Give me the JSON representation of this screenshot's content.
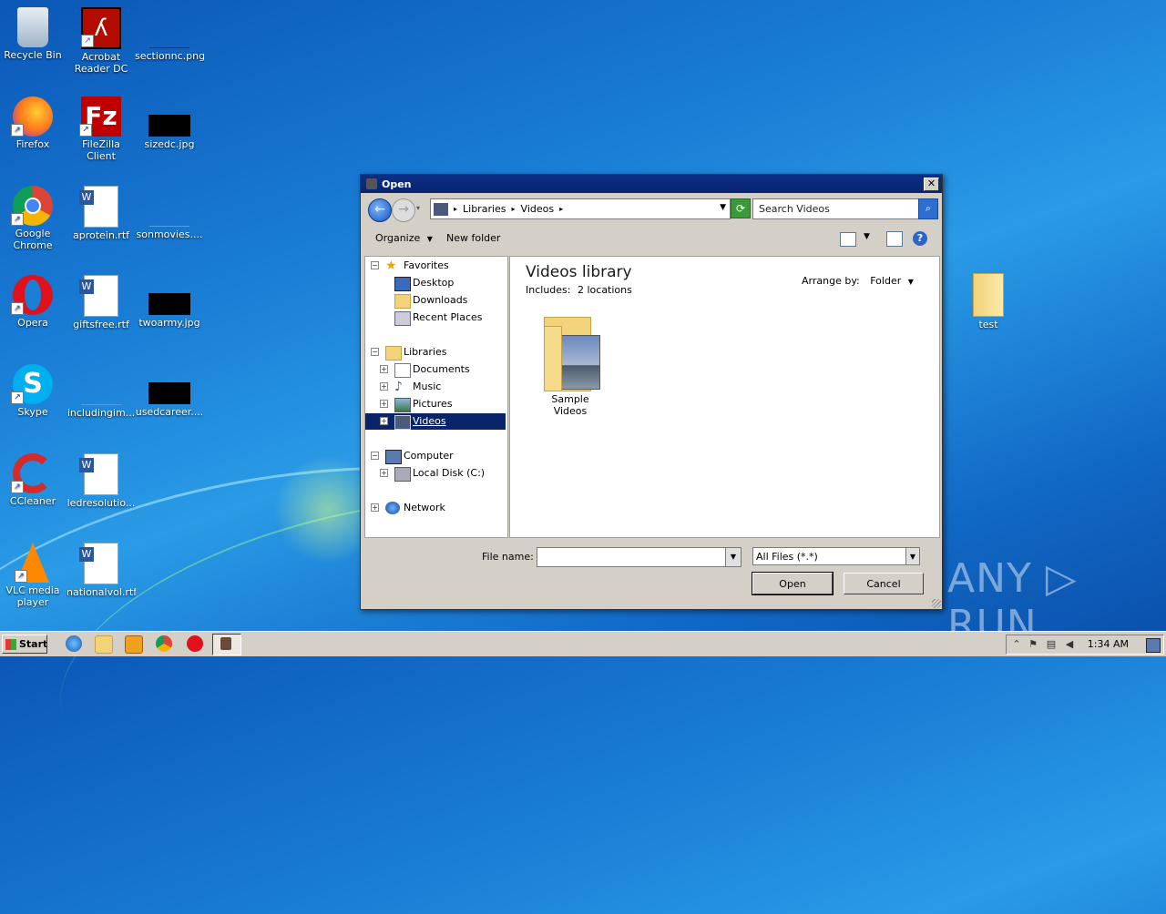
{
  "desktop": {
    "icons": [
      {
        "label": "Recycle Bin"
      },
      {
        "label": "Acrobat Reader DC"
      },
      {
        "label": "sectionnc.png"
      },
      {
        "label": "Firefox"
      },
      {
        "label": "FileZilla Client"
      },
      {
        "label": "sizedc.jpg"
      },
      {
        "label": "Google Chrome"
      },
      {
        "label": "aprotein.rtf"
      },
      {
        "label": "sonmovies...."
      },
      {
        "label": "Opera"
      },
      {
        "label": "giftsfree.rtf"
      },
      {
        "label": "twoarmy.jpg"
      },
      {
        "label": "Skype"
      },
      {
        "label": "includingim..."
      },
      {
        "label": "usedcareer...."
      },
      {
        "label": "CCleaner"
      },
      {
        "label": "ledresolutio..."
      },
      {
        "label": "VLC media player"
      },
      {
        "label": "nationalvol.rtf"
      },
      {
        "label": "test"
      }
    ],
    "watermark": "ANY ▷ RUN"
  },
  "dialog": {
    "title": "Open",
    "close_glyph": "✕",
    "address": {
      "crumbs": [
        "Libraries",
        "Videos"
      ]
    },
    "search": {
      "placeholder": "Search Videos"
    },
    "toolbar": {
      "organize": "Organize",
      "new_folder": "New folder"
    },
    "nav": {
      "favorites": "Favorites",
      "desktop": "Desktop",
      "downloads": "Downloads",
      "recent_places": "Recent Places",
      "libraries": "Libraries",
      "documents": "Documents",
      "music": "Music",
      "pictures": "Pictures",
      "videos": "Videos",
      "computer": "Computer",
      "local_disk": "Local Disk (C:)",
      "network": "Network"
    },
    "content": {
      "title": "Videos library",
      "includes_label": "Includes:",
      "includes_value": "2 locations",
      "arrange_label": "Arrange by:",
      "arrange_value": "Folder",
      "items": [
        {
          "label": "Sample Videos"
        }
      ]
    },
    "bottom": {
      "file_name_label": "File name:",
      "file_name_value": "",
      "file_type": "All Files (*.*)",
      "open_label": "Open",
      "cancel_label": "Cancel"
    }
  },
  "taskbar": {
    "start_label": "Start",
    "clock": "1:34 AM"
  },
  "colors": {
    "selection": "#0a246a",
    "titlebar": "#0b2f86",
    "desktop": "#1a7fd6"
  }
}
